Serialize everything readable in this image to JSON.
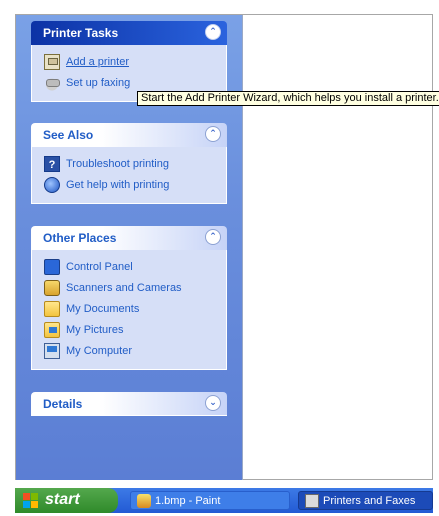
{
  "panels": {
    "printer_tasks": {
      "title": "Printer Tasks",
      "items": [
        {
          "label": "Add a printer",
          "icon": "add-printer-icon"
        },
        {
          "label": "Set up faxing",
          "icon": "fax-icon"
        }
      ]
    },
    "see_also": {
      "title": "See Also",
      "items": [
        {
          "label": "Troubleshoot printing",
          "icon": "help-icon"
        },
        {
          "label": "Get help with printing",
          "icon": "globe-help-icon"
        }
      ]
    },
    "other_places": {
      "title": "Other Places",
      "items": [
        {
          "label": "Control Panel",
          "icon": "control-panel-icon"
        },
        {
          "label": "Scanners and Cameras",
          "icon": "scanner-icon"
        },
        {
          "label": "My Documents",
          "icon": "folder-icon"
        },
        {
          "label": "My Pictures",
          "icon": "pictures-icon"
        },
        {
          "label": "My Computer",
          "icon": "computer-icon"
        }
      ]
    },
    "details": {
      "title": "Details"
    }
  },
  "tooltip": "Start the Add Printer Wizard, which helps you install a printer.",
  "taskbar": {
    "start_label": "start",
    "tasks": [
      {
        "label": "1.bmp - Paint",
        "icon": "paint-icon"
      },
      {
        "label": "Printers and Faxes",
        "icon": "printers-icon"
      }
    ]
  },
  "colors": {
    "taskpane": "#6a8fdd",
    "header_dark": "#0c32a5",
    "link": "#215dc6",
    "tooltip_bg": "#ffffe1",
    "start_green": "#2f8a2a",
    "taskbar_blue": "#225ad4"
  }
}
